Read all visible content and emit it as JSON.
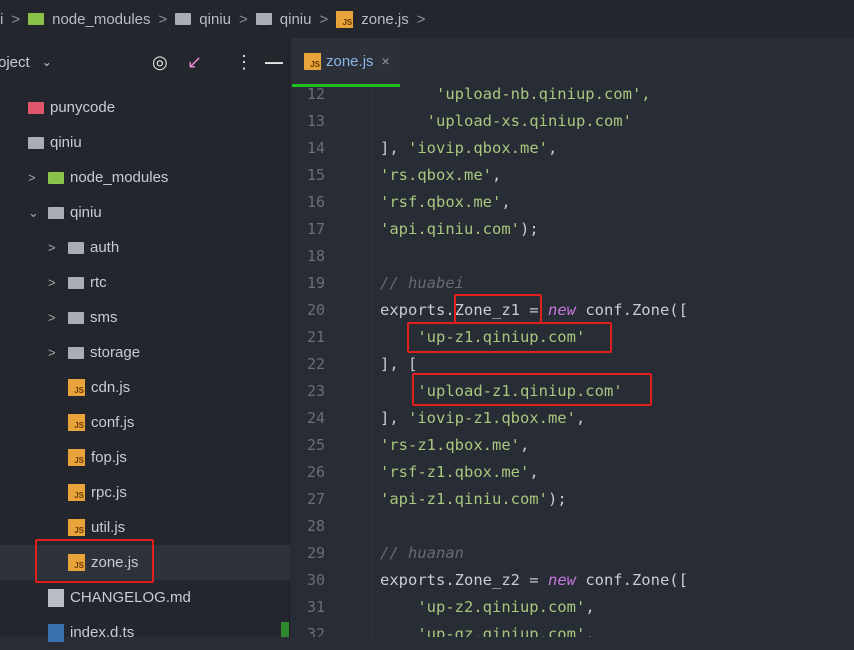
{
  "breadcrumb": [
    "i",
    "node_modules",
    "qiniu",
    "qiniu",
    "zone.js"
  ],
  "sidebar": {
    "title": "oject",
    "items": [
      {
        "label": "punycode",
        "type": "folder-red",
        "depth": 0,
        "arrow": ""
      },
      {
        "label": "qiniu",
        "type": "folder",
        "depth": 0,
        "arrow": ""
      },
      {
        "label": "node_modules",
        "type": "folder-green",
        "depth": 1,
        "arrow": ">"
      },
      {
        "label": "qiniu",
        "type": "folder",
        "depth": 1,
        "arrow": "v"
      },
      {
        "label": "auth",
        "type": "folder",
        "depth": 2,
        "arrow": ">"
      },
      {
        "label": "rtc",
        "type": "folder",
        "depth": 2,
        "arrow": ">"
      },
      {
        "label": "sms",
        "type": "folder",
        "depth": 2,
        "arrow": ">"
      },
      {
        "label": "storage",
        "type": "folder",
        "depth": 2,
        "arrow": ">"
      },
      {
        "label": "cdn.js",
        "type": "js",
        "depth": 2,
        "arrow": ""
      },
      {
        "label": "conf.js",
        "type": "js",
        "depth": 2,
        "arrow": ""
      },
      {
        "label": "fop.js",
        "type": "js",
        "depth": 2,
        "arrow": ""
      },
      {
        "label": "rpc.js",
        "type": "js",
        "depth": 2,
        "arrow": ""
      },
      {
        "label": "util.js",
        "type": "js",
        "depth": 2,
        "arrow": ""
      },
      {
        "label": "zone.js",
        "type": "js",
        "depth": 2,
        "arrow": "",
        "selected": true
      },
      {
        "label": "CHANGELOG.md",
        "type": "md",
        "depth": 1,
        "arrow": ""
      },
      {
        "label": "index.d.ts",
        "type": "ts",
        "depth": 1,
        "arrow": ""
      }
    ]
  },
  "tab": {
    "label": "zone.js",
    "close": "×"
  },
  "code": [
    {
      "n": "12",
      "t": [
        [
          "s",
          "      'upload-nb.qiniup.com',"
        ]
      ]
    },
    {
      "n": "13",
      "t": [
        [
          "s",
          "     'upload-xs.qiniup.com'"
        ]
      ]
    },
    {
      "n": "14",
      "t": [
        [
          "p",
          "], "
        ],
        [
          "s",
          "'iovip.qbox.me'"
        ],
        [
          "p",
          ","
        ]
      ]
    },
    {
      "n": "15",
      "t": [
        [
          "s",
          "'rs.qbox.me'"
        ],
        [
          "p",
          ","
        ]
      ]
    },
    {
      "n": "16",
      "t": [
        [
          "s",
          "'rsf.qbox.me'"
        ],
        [
          "p",
          ","
        ]
      ]
    },
    {
      "n": "17",
      "t": [
        [
          "s",
          "'api.qiniu.com'"
        ],
        [
          "p",
          ");"
        ]
      ]
    },
    {
      "n": "18",
      "t": []
    },
    {
      "n": "19",
      "t": [
        [
          "c",
          "// huabei"
        ]
      ]
    },
    {
      "n": "20",
      "t": [
        [
          "p",
          "exports.Zone_z1 = "
        ],
        [
          "k",
          "new"
        ],
        [
          "p",
          " conf.Zone(["
        ]
      ]
    },
    {
      "n": "21",
      "t": [
        [
          "p",
          "    "
        ],
        [
          "s",
          "'up-z1.qiniup.com'"
        ]
      ]
    },
    {
      "n": "22",
      "t": [
        [
          "p",
          "], ["
        ]
      ]
    },
    {
      "n": "23",
      "t": [
        [
          "p",
          "    "
        ],
        [
          "s",
          "'upload-z1.qiniup.com'"
        ]
      ]
    },
    {
      "n": "24",
      "t": [
        [
          "p",
          "], "
        ],
        [
          "s",
          "'iovip-z1.qbox.me'"
        ],
        [
          "p",
          ","
        ]
      ]
    },
    {
      "n": "25",
      "t": [
        [
          "s",
          "'rs-z1.qbox.me'"
        ],
        [
          "p",
          ","
        ]
      ]
    },
    {
      "n": "26",
      "t": [
        [
          "s",
          "'rsf-z1.qbox.me'"
        ],
        [
          "p",
          ","
        ]
      ]
    },
    {
      "n": "27",
      "t": [
        [
          "s",
          "'api-z1.qiniu.com'"
        ],
        [
          "p",
          ");"
        ]
      ]
    },
    {
      "n": "28",
      "t": []
    },
    {
      "n": "29",
      "t": [
        [
          "c",
          "// huanan"
        ]
      ]
    },
    {
      "n": "30",
      "t": [
        [
          "p",
          "exports.Zone_z2 = "
        ],
        [
          "k",
          "new"
        ],
        [
          "p",
          " conf.Zone(["
        ]
      ]
    },
    {
      "n": "31",
      "t": [
        [
          "p",
          "    "
        ],
        [
          "s",
          "'up-z2.qiniup.com'"
        ],
        [
          "p",
          ","
        ]
      ]
    },
    {
      "n": "32",
      "t": [
        [
          "p",
          "    "
        ],
        [
          "s",
          "'up-gz.qiniup.com'"
        ],
        [
          "p",
          ","
        ]
      ]
    }
  ]
}
